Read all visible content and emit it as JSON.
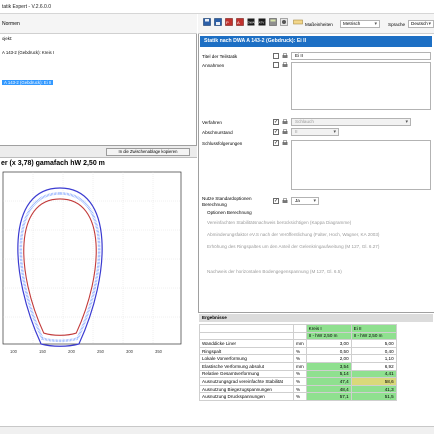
{
  "window": {
    "title": "tatik Expert - V.2.6.0.0"
  },
  "left_menu": {
    "item": "Normen"
  },
  "tree": {
    "items": [
      {
        "label": "ojekt:"
      },
      {
        "label": "A 143-2 (Gebdruck): Kreis I"
      },
      {
        "label": "A 143-2 (Gebdruck): Ei II",
        "selected": true
      }
    ]
  },
  "chart_panel": {
    "copy_button": "In die Zwischenablage kopieren",
    "title": "er (x 3,78)  gamafach hW 2,50 m"
  },
  "chart_data": {
    "type": "line",
    "title": "er (x 3,78)  gamafach hW 2,50 m",
    "x_ticks": [
      "100",
      "150",
      "200",
      "250",
      "300",
      "350"
    ],
    "series": [
      {
        "values": []
      },
      {
        "values": []
      },
      {
        "values": []
      }
    ],
    "grid": true,
    "colors": {
      "outer": "#3b3bd1",
      "inner": "#c23a3a",
      "fill": "#7aa0ff"
    }
  },
  "toolbar": {
    "view_label": "Maßeinheiten",
    "unit_value": "Metrisch",
    "language_label": "Sprache",
    "language_value": "Deutsch"
  },
  "form": {
    "header": "Statik nach DWA A 143-2 (Gebdruck): Ei II",
    "titel_label": "Titel der Teilstatik",
    "titel_value": "Ei II",
    "annahmen_label": "Annahmen",
    "verfahren_label": "Verfahren",
    "verfahren_value": "Schlauch",
    "abschnitt_label": "Abschnurstand",
    "abschnitt_value": "II",
    "schluss_label": "Schlussfolgerungen",
    "std_label_1": "Nutze Standardoptionen",
    "std_label_2": "Berechnung",
    "std_value": "Ja",
    "optionen_label": "Optionen Berechnung",
    "opt1": "Vereinfachten Stabilitätsnachweis berücksichtigen (Kappa Diagramme)",
    "opt2": "Abminderungsfaktor eV.S nach der Veröffentlichung (Falter, Hoch, Wagner, KA 2003)",
    "opt3": "Erhöhung des Ringspaltes um den Anteil der Gelenkringaufweitung (M 127, Gl. 6.27)",
    "opt4": "Nachweis der horizontalen Bodengegenspannung (M 127, Gl. 6.5)"
  },
  "results": {
    "header": "Ergebnisse",
    "columns": [
      "",
      "",
      "Kreis I",
      "Ei II"
    ],
    "subheader": [
      "",
      "",
      "II - hW 2,50 m",
      "II - hW 2,50 m"
    ],
    "rows": [
      {
        "label": "Wanddicke Liner",
        "unit": "mm",
        "a": "3,00",
        "b": "5,00",
        "ca": "",
        "cb": ""
      },
      {
        "label": "Ringspalt",
        "unit": "%",
        "a": "0,50",
        "b": "0,40",
        "ca": "",
        "cb": ""
      },
      {
        "label": "Lokale Vorverformung",
        "unit": "%",
        "a": "2,00",
        "b": "1,10",
        "ca": "",
        "cb": ""
      },
      {
        "label": "Elastische Verformung absolut",
        "unit": "mm",
        "a": "3,54",
        "b": "6,92",
        "ca": "g",
        "cb": ""
      },
      {
        "label": "Relative Gesamtverformung",
        "unit": "%",
        "a": "5,14",
        "b": "4,41",
        "ca": "g",
        "cb": "g"
      },
      {
        "label": "Ausnutzungsgrad vereinfachte Stabilität",
        "unit": "%",
        "a": "47,4",
        "b": "58,6",
        "ca": "g",
        "cb": "y"
      },
      {
        "label": "Ausnutzung Biegezugspannungen",
        "unit": "%",
        "a": "48,4",
        "b": "41,3",
        "ca": "g",
        "cb": "g"
      },
      {
        "label": "Ausnutzung Druckspannungen",
        "unit": "%",
        "a": "57,1",
        "b": "51,5",
        "ca": "g",
        "cb": "g"
      }
    ]
  }
}
